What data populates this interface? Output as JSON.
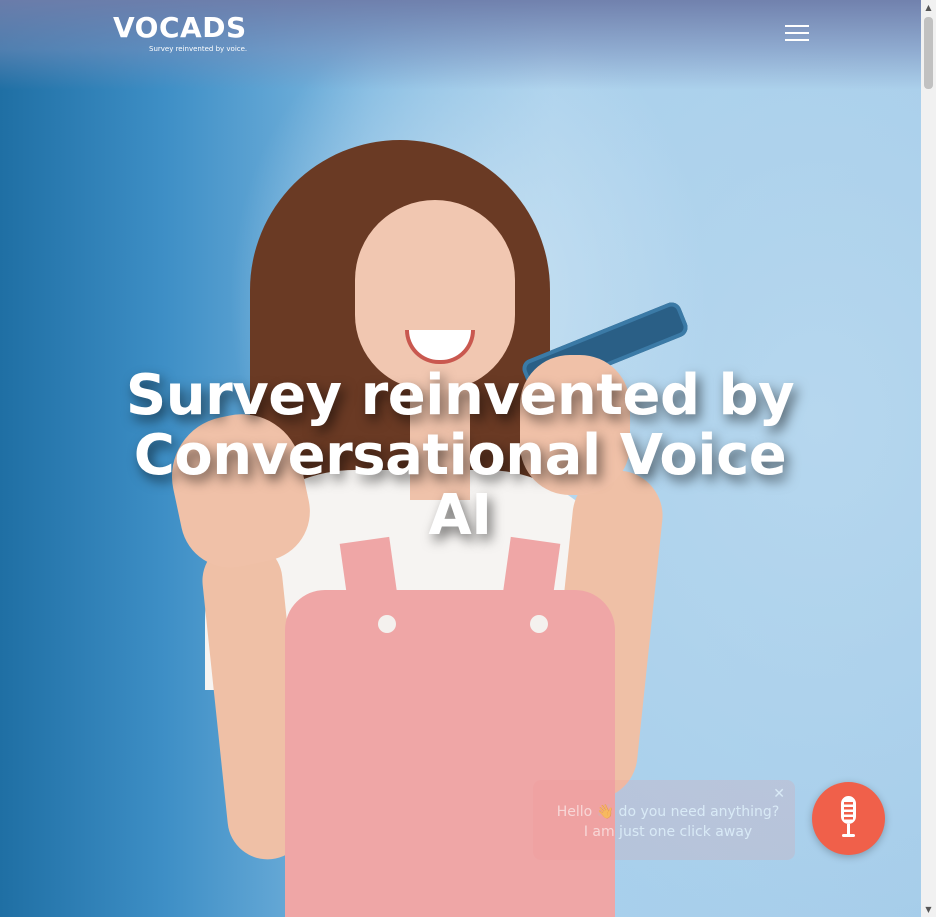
{
  "header": {
    "logo_text": "VOCADS",
    "logo_tagline": "Survey reinvented by voice.",
    "menu_icon": "hamburger-menu-icon"
  },
  "hero": {
    "title": "Survey reinvented by Conversational Voice AI",
    "image_icon": "smiling-woman-with-phone-photo"
  },
  "chat_popup": {
    "message": "Hello 👋 do you need anything? I am just one click away",
    "close_icon": "close-icon"
  },
  "voice_button": {
    "icon": "microphone-icon",
    "color": "#f0604a"
  },
  "colors": {
    "background_blue": "#7eb8e0",
    "accent_orange": "#f0604a",
    "title_white": "#ffffff"
  }
}
